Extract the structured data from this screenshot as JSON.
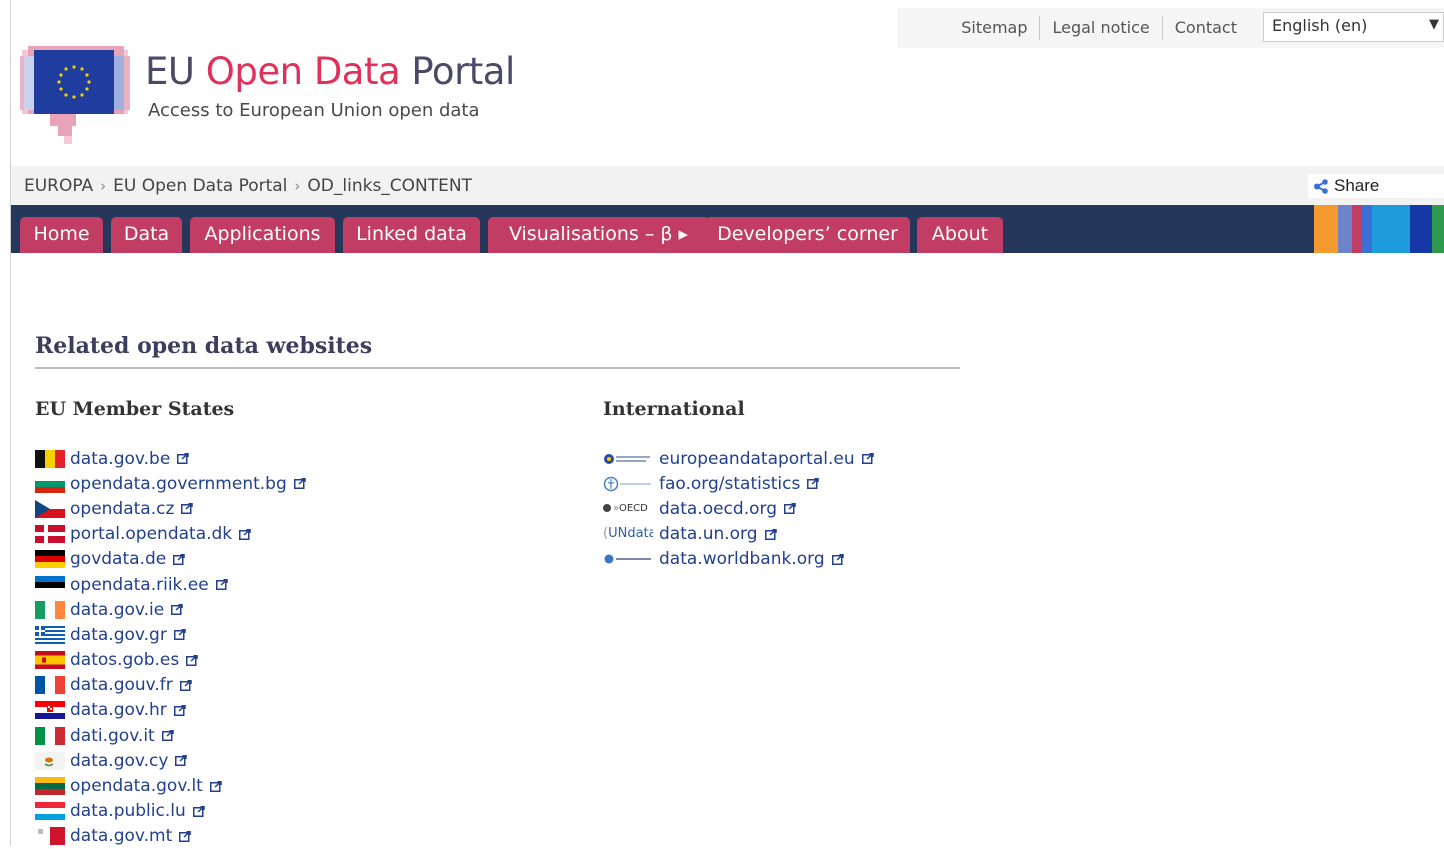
{
  "topbar": {
    "links": [
      "Sitemap",
      "Legal notice",
      "Contact"
    ],
    "language": "English (en)"
  },
  "brand": {
    "title_start": "EU ",
    "title_accent": "Open Data",
    "title_end": " Portal",
    "subtitle": "Access to European Union open data"
  },
  "breadcrumb": {
    "items": [
      "EUROPA",
      "EU Open Data Portal",
      "OD_links_CONTENT"
    ],
    "separator": "›",
    "share_label": "Share"
  },
  "nav": {
    "tabs": [
      "Home",
      "Data",
      "Applications",
      "Linked data",
      "Visualisations – β ▸",
      "Developers’ corner",
      "About"
    ]
  },
  "content": {
    "heading": "Related open data websites",
    "eu_heading": "EU Member States",
    "intl_heading": "International",
    "eu_links": [
      {
        "label": "data.gov.be",
        "flag": "BE"
      },
      {
        "label": "opendata.government.bg",
        "flag": "BG"
      },
      {
        "label": "opendata.cz",
        "flag": "CZ"
      },
      {
        "label": "portal.opendata.dk",
        "flag": "DK"
      },
      {
        "label": "govdata.de",
        "flag": "DE"
      },
      {
        "label": "opendata.riik.ee",
        "flag": "EE"
      },
      {
        "label": "data.gov.ie",
        "flag": "IE"
      },
      {
        "label": "data.gov.gr",
        "flag": "GR"
      },
      {
        "label": "datos.gob.es",
        "flag": "ES"
      },
      {
        "label": "data.gouv.fr",
        "flag": "FR"
      },
      {
        "label": "data.gov.hr",
        "flag": "HR"
      },
      {
        "label": "dati.gov.it",
        "flag": "IT"
      },
      {
        "label": "data.gov.cy",
        "flag": "CY"
      },
      {
        "label": "opendata.gov.lt",
        "flag": "LT"
      },
      {
        "label": "data.public.lu",
        "flag": "LU"
      },
      {
        "label": "data.gov.mt",
        "flag": "MT"
      }
    ],
    "intl_links": [
      {
        "label": "europeandataportal.eu",
        "logo": "european-data-portal-logo"
      },
      {
        "label": "fao.org/statistics",
        "logo": "fao-logo"
      },
      {
        "label": "data.oecd.org",
        "logo": "oecd-logo",
        "logo_text": "OECD"
      },
      {
        "label": "data.un.org",
        "logo": "undata-logo",
        "logo_text": "UNdata"
      },
      {
        "label": "data.worldbank.org",
        "logo": "worldbank-logo"
      }
    ]
  },
  "colors": {
    "brand_accent": "#e0315b",
    "nav_background": "#25375b",
    "tab_background": "#c23d63",
    "link": "#23408f"
  },
  "icons": [
    "eu-open-data-logo",
    "share-icon",
    "external-link-icon",
    "chevron-down-icon"
  ]
}
